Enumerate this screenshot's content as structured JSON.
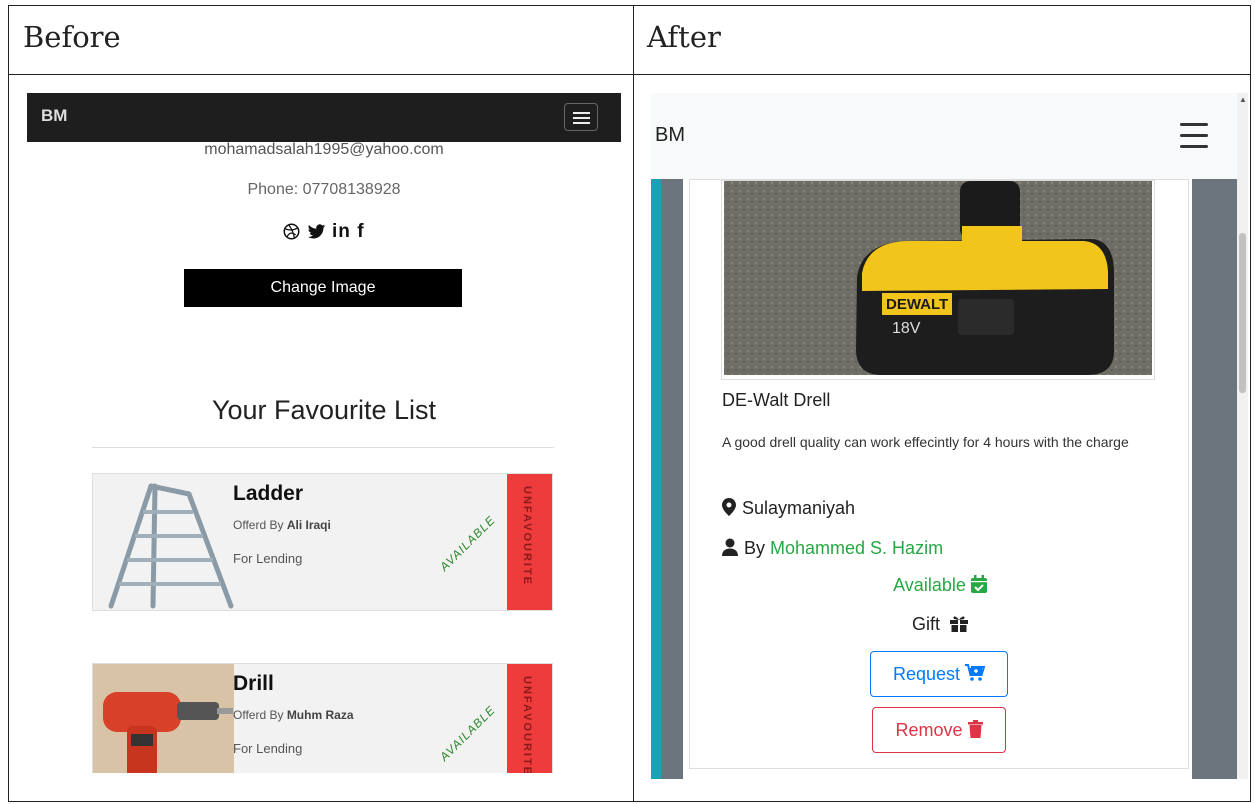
{
  "columns": {
    "before": "Before",
    "after": "After"
  },
  "before": {
    "brand": "BM",
    "email": "mohamadsalah1995@yahoo.com",
    "phone": "Phone: 07708138928",
    "social_icons": [
      "dribbble-icon",
      "twitter-icon",
      "linkedin-icon",
      "facebook-icon"
    ],
    "change_image_label": "Change Image",
    "favourites_title": "Your Favourite List",
    "favourites": [
      {
        "title": "Ladder",
        "offered_prefix": "Offerd By ",
        "owner": "Ali Iraqi",
        "type": "For Lending",
        "status": "AVAILABLE",
        "action": "UNFAVOURITE",
        "image_icon": "ladder-image"
      },
      {
        "title": "Drill",
        "offered_prefix": "Offerd By ",
        "owner": "Muhm Raza",
        "type": "For Lending",
        "status": "AVAILABLE",
        "action": "UNFAVOURITE",
        "image_icon": "drill-image"
      }
    ],
    "colors": {
      "navbar": "#1e1e1e",
      "unfavourite": "#ee3b3b",
      "available": "#2d8a2d"
    }
  },
  "after": {
    "brand": "BM",
    "item": {
      "name": "DE-Walt Drell",
      "description": "A good drell quality can work effecintly for 4 hours with the charge",
      "location": "Sulaymaniyah",
      "by_prefix": "By ",
      "owner": "Mohammed S. Hazim",
      "status": "Available",
      "type": "Gift",
      "request_label": "Request",
      "remove_label": "Remove",
      "image_icon": "dewalt-battery-image",
      "image_text": {
        "brand": "DEWALT",
        "voltage": "18V"
      }
    },
    "colors": {
      "accent_green": "#28a745",
      "request": "#007bff",
      "remove": "#dc3545",
      "sidebar_teal": "#17a2b8",
      "panel_gray": "#6c757d"
    }
  }
}
